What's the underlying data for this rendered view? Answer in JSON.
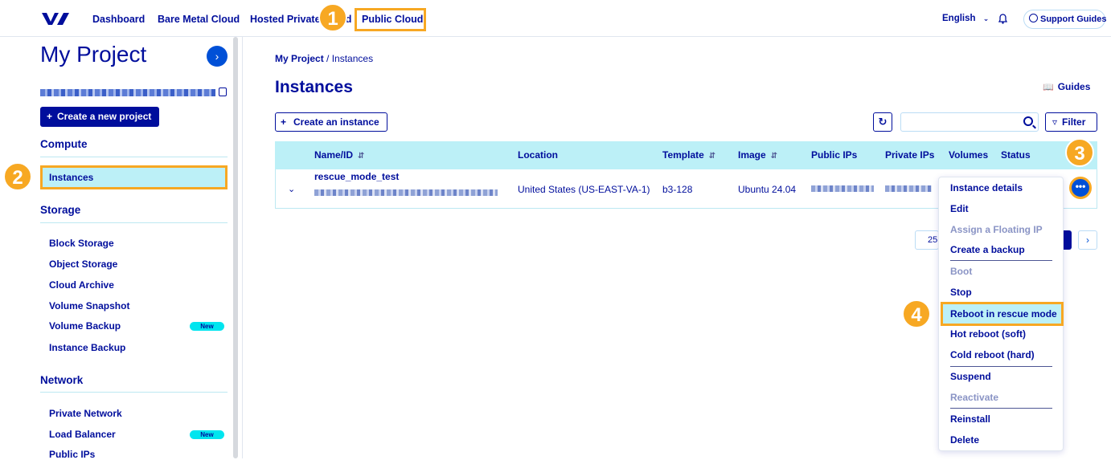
{
  "header": {
    "nav": [
      "Dashboard",
      "Bare Metal Cloud",
      "Hosted Private Cloud",
      "Public Cloud"
    ],
    "language": "English",
    "support": "Support Guides"
  },
  "badges": [
    "1",
    "2",
    "3",
    "4"
  ],
  "sidebar": {
    "project_title": "My Project",
    "create_project": "Create a new project",
    "sections": {
      "compute": "Compute",
      "storage": "Storage",
      "network": "Network"
    },
    "compute_items": [
      "Instances"
    ],
    "storage_items": [
      "Block Storage",
      "Object Storage",
      "Cloud Archive",
      "Volume Snapshot",
      "Volume Backup",
      "Instance Backup"
    ],
    "network_items": [
      "Private Network",
      "Load Balancer",
      "Public IPs"
    ],
    "new_label": "New"
  },
  "main": {
    "breadcrumb_root": "My Project",
    "breadcrumb_sep": "/",
    "breadcrumb_current": "Instances",
    "title": "Instances",
    "guides": "Guides",
    "create_instance": "Create an instance",
    "filter": "Filter",
    "columns": [
      "Name/ID",
      "Location",
      "Template",
      "Image",
      "Public IPs",
      "Private IPs",
      "Volumes",
      "Status"
    ],
    "row": {
      "name": "rescue_mode_test",
      "location": "United States (US-EAST-VA-1)",
      "template": "b3-128",
      "image": "Ubuntu 24.04"
    },
    "pager_size": "25"
  },
  "action_menu": {
    "items": [
      "Instance details",
      "Edit",
      "Assign a Floating IP",
      "Create a backup",
      "Boot",
      "Stop",
      "Reboot in rescue mode",
      "Hot reboot (soft)",
      "Cold reboot (hard)",
      "Suspend",
      "Reactivate",
      "Reinstall",
      "Delete"
    ]
  },
  "colors": {
    "brand": "#000e9c",
    "accent": "#0050d7",
    "highlight": "#f7a823",
    "table_header": "#bcf0f7",
    "new_badge": "#00e5ef"
  }
}
